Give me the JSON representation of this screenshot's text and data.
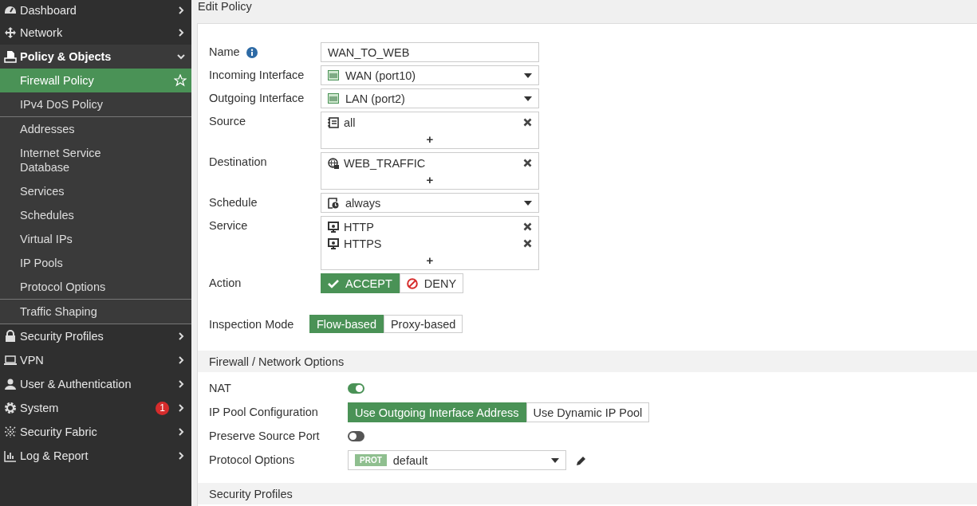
{
  "sidebar": {
    "items": [
      {
        "label": "Dashboard",
        "expanded": false
      },
      {
        "label": "Network",
        "expanded": false
      },
      {
        "label": "Policy & Objects",
        "expanded": true,
        "child_groups": [
          [
            {
              "label": "Firewall Policy",
              "selected": true
            },
            {
              "label": "IPv4 DoS Policy",
              "selected": false
            }
          ],
          [
            {
              "label": "Addresses",
              "selected": false
            },
            {
              "label": "Internet Service Database",
              "selected": false
            },
            {
              "label": "Services",
              "selected": false
            },
            {
              "label": "Schedules",
              "selected": false
            },
            {
              "label": "Virtual IPs",
              "selected": false
            },
            {
              "label": "IP Pools",
              "selected": false
            },
            {
              "label": "Protocol Options",
              "selected": false
            }
          ],
          [
            {
              "label": "Traffic Shaping",
              "selected": false
            }
          ]
        ]
      },
      {
        "label": "Security Profiles",
        "expanded": false
      },
      {
        "label": "VPN",
        "expanded": false
      },
      {
        "label": "User & Authentication",
        "expanded": false
      },
      {
        "label": "System",
        "expanded": false,
        "badge": "1"
      },
      {
        "label": "Security Fabric",
        "expanded": false
      },
      {
        "label": "Log & Report",
        "expanded": false
      }
    ]
  },
  "page": {
    "title": "Edit Policy"
  },
  "sections": [
    {
      "rows": [
        {
          "kind": "text",
          "label": "Name",
          "value": "WAN_TO_WEB",
          "info": true
        },
        {
          "kind": "select",
          "label": "Incoming Interface",
          "value": "WAN (port10)"
        },
        {
          "kind": "select",
          "label": "Outgoing Interface",
          "value": "LAN (port2)"
        },
        {
          "kind": "multi",
          "label": "Source",
          "entries": [
            "all"
          ],
          "add": "+"
        },
        {
          "kind": "multi",
          "label": "Destination",
          "entries": [
            "WEB_TRAFFIC"
          ],
          "add": "+"
        },
        {
          "kind": "select",
          "label": "Schedule",
          "value": "always"
        },
        {
          "kind": "multi",
          "label": "Service",
          "entries": [
            "HTTP",
            "HTTPS"
          ],
          "add": "+"
        },
        {
          "kind": "choice",
          "label": "Action",
          "options": [
            {
              "label": "ACCEPT",
              "selected": true
            },
            {
              "label": "DENY",
              "selected": false
            }
          ]
        },
        {
          "kind": "choice",
          "label": "Inspection Mode",
          "options": [
            {
              "label": "Flow-based",
              "selected": true
            },
            {
              "label": "Proxy-based",
              "selected": false
            }
          ]
        }
      ]
    },
    {
      "title": "Firewall / Network Options",
      "rows": [
        {
          "kind": "toggle",
          "label": "NAT",
          "on": true
        },
        {
          "kind": "choice",
          "label": "IP Pool Configuration",
          "options": [
            {
              "label": "Use Outgoing Interface Address",
              "selected": true
            },
            {
              "label": "Use Dynamic IP Pool",
              "selected": false
            }
          ]
        },
        {
          "kind": "toggle",
          "label": "Preserve Source Port",
          "on": false
        },
        {
          "kind": "select",
          "label": "Protocol Options",
          "tag": "PROT",
          "value": "default",
          "editable": true
        }
      ]
    },
    {
      "title": "Security Profiles"
    }
  ]
}
